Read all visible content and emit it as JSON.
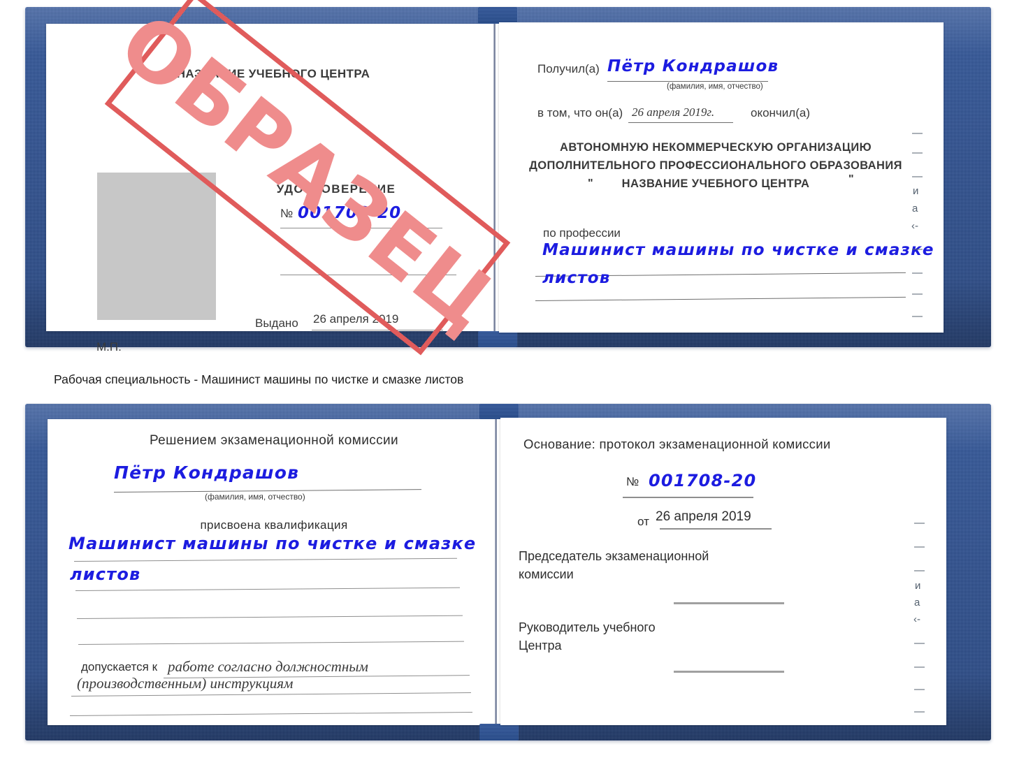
{
  "document": {
    "type": "certificate-scan",
    "language": "ru",
    "watermark": {
      "text": "ОБРАЗЕЦ",
      "color": "#e05b5b"
    },
    "colors": {
      "cover_blue": "#274d94",
      "ink_blue": "#1c1ce0",
      "stamp_red": "#e05b5b",
      "photo_placeholder_grey": "#c7c7c7",
      "rule_grey": "#8e8e8e"
    }
  },
  "caption": {
    "text": "Рабочая специальность - Машинист машины по чистке и смазке листов"
  },
  "certificate_front": {
    "left_page": {
      "org_title": "НАЗВАНИЕ УЧЕБНОГО ЦЕНТРА",
      "doc_title": "УДОСТОВЕРЕНИЕ",
      "number_label": "№",
      "number_value": "001708-20",
      "issued_label": "Выдано",
      "issued_value": "26 апреля 2019",
      "seal_label": "М.П.",
      "photo_placeholder": ""
    },
    "right_page": {
      "received_label": "Получил(а)",
      "received_value": "Пётр Кондрашов",
      "fio_hint": "(фамилия, имя, отчество)",
      "in_that_label": "в том, что он(а)",
      "date_value": "26 апреля 2019г.",
      "finished_label": "окончил(а)",
      "org_line1": "АВТОНОМНУЮ НЕКОММЕРЧЕСКУЮ ОРГАНИЗАЦИЮ",
      "org_line2": "ДОПОЛНИТЕЛЬНОГО ПРОФЕССИОНАЛЬНОГО ОБРАЗОВАНИЯ",
      "org_quote_open": "\"",
      "org_line3": "НАЗВАНИЕ УЧЕБНОГО ЦЕНТРА",
      "org_quote_close": "\"",
      "profession_label": "по профессии",
      "profession_value_line1": "Машинист машины по чистке и смазке",
      "profession_value_line2": "листов",
      "edge_marks": [
        "—",
        "—",
        "—",
        "и",
        "а",
        "‹-",
        "—",
        "—",
        "—",
        "—"
      ]
    }
  },
  "certificate_back": {
    "left_page": {
      "heading": "Решением экзаменационной комиссии",
      "name_value": "Пётр Кондрашов",
      "fio_hint": "(фамилия, имя, отчество)",
      "qualification_label": "присвоена квалификация",
      "qualification_line1": "Машинист машины по чистке и смазке",
      "qualification_line2": "листов",
      "admitted_label": "допускается к",
      "admitted_value_line1": "работе согласно должностным",
      "admitted_value_line2": "(производственным) инструкциям"
    },
    "right_page": {
      "basis_label": "Основание: протокол экзаменационной комиссии",
      "number_label": "№",
      "number_value": "001708-20",
      "date_label": "от",
      "date_value": "26 апреля 2019",
      "chair_line1": "Председатель экзаменационной",
      "chair_line2": "комиссии",
      "head_line1": "Руководитель учебного",
      "head_line2": "Центра",
      "edge_marks": [
        "—",
        "—",
        "—",
        "и",
        "а",
        "‹-",
        "—",
        "—",
        "—",
        "—"
      ]
    }
  }
}
